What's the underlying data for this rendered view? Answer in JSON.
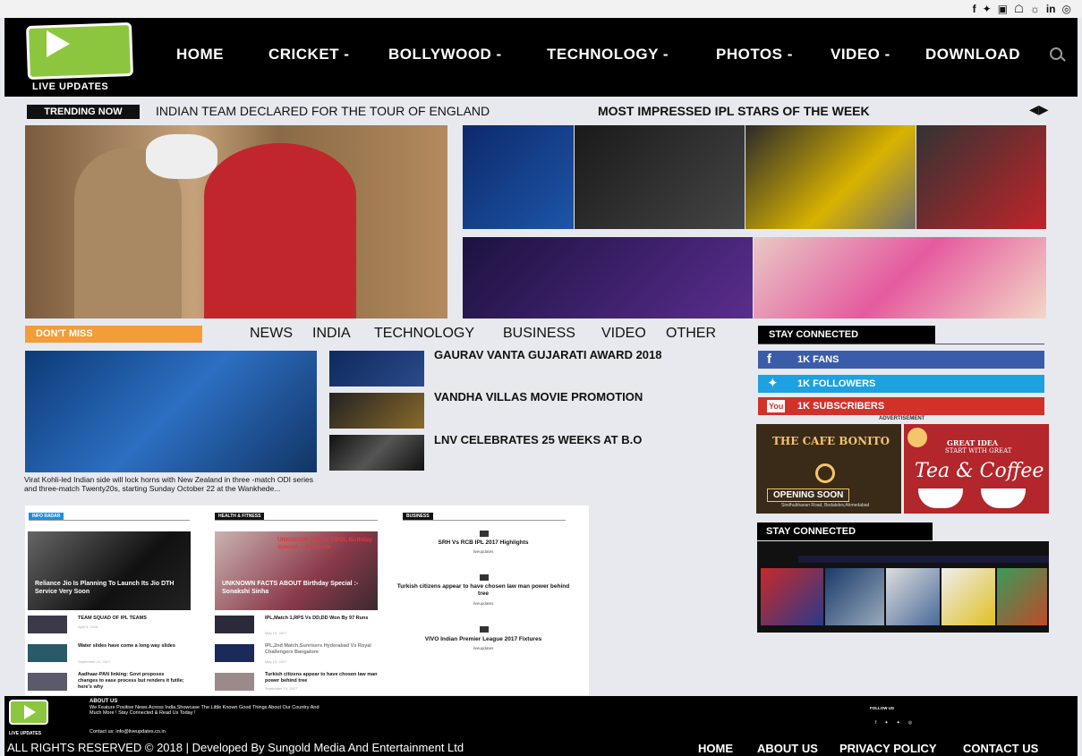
{
  "top_social": [
    "f",
    "✦",
    "▣",
    "☖",
    "☼",
    "in",
    "◎"
  ],
  "logo": {
    "text": "LIVE UPDATES"
  },
  "nav": [
    "HOME",
    "CRICKET -",
    "BOLLYWOOD -",
    "TECHNOLOGY -",
    "PHOTOS -",
    "VIDEO -",
    "DOWNLOAD"
  ],
  "trending": {
    "badge": "TRENDING NOW",
    "headline": "INDIAN TEAM DECLARED FOR THE TOUR OF ENGLAND",
    "headline2": "MOST IMPRESSED IPL STARS OF THE WEEK",
    "arrows": "◀▶"
  },
  "dont_miss": {
    "badge": "DON'T MISS",
    "categories": [
      "NEWS",
      "INDIA",
      "TECHNOLOGY",
      "BUSINESS",
      "VIDEO",
      "OTHER"
    ],
    "main_caption": "Virat Kohli-led Indian side will lock horns with New Zealand in three -match ODI series and three-match Twenty20s, starting Sunday October 22 at the Wankhede...",
    "stories": [
      "GAURAV VANTA GUJARATI AWARD 2018",
      "VANDHA VILLAS MOVIE PROMOTION",
      "LNV CELEBRATES 25 WEEKS AT B.O"
    ]
  },
  "stay_connected": {
    "title": "STAY CONNECTED",
    "facebook": "1K FANS",
    "twitter": "1K FOLLOWERS",
    "youtube": "1K SUBSCRIBERS",
    "colors": {
      "facebook": "#3b5ca8",
      "twitter": "#1da1e0",
      "youtube": "#d2312a"
    }
  },
  "advertisement": {
    "label": "ADVERTISEMENT",
    "ad1_title": "THE CAFE BONITO",
    "ad1_open": "OPENING SOON",
    "ad1_loc": "Sindhubhavan Road, Bodakdev,Ahmedabad",
    "ad2_line1": "GREAT IDEA",
    "ad2_line2": "START WITH GREAT",
    "ad2_main": "Tea & Coffee"
  },
  "panel": {
    "col1": {
      "header": "INFO RADAR",
      "feature": "Reliance Jio Is Planning To Launch Its Jio DTH Service Very Soon",
      "items": [
        {
          "title": "TEAM SQUAD OF IPL TEAMS",
          "date": "April 9, 2018"
        },
        {
          "title": "Water slides have come a long way slides",
          "date": "September 19, 2017"
        },
        {
          "title": "Aadhaar-PAN linking: Govt proposes changes to ease process but renders it futile; here's why",
          "date": ""
        }
      ]
    },
    "col2": {
      "header": "HEALTH & FITNESS",
      "feature": "UNKNOWN FACTS ABOUT Birthday Special :- Sonakshi Sinha",
      "feature_overlay": "UNKNOWN FACTS ABOL Birthday Special :- Sonakshi",
      "items": [
        {
          "title": "IPL,Match 1,RPS Vs DD,DD Won By 97 Runs",
          "date": "May 15, 2017"
        },
        {
          "title": "IPL,2nd Match,Sunrisers Hyderabad Vs Royal Challengers Bangalore",
          "date": "May 15, 2017"
        },
        {
          "title": "Turkish citizens appear to have chosen law man power behind tree",
          "date": "September 19, 2017"
        }
      ]
    },
    "col3": {
      "header": "BUSINESS",
      "items": [
        {
          "title": "SRH Vs RCB IPL 2017 Highlights",
          "meta": "liveupdates"
        },
        {
          "title": "Turkish citizens appear to have chosen law man power behind tree",
          "meta": "liveupdates"
        },
        {
          "title": "VIVO Indian Premier League 2017 Fixtures",
          "meta": "liveupdates"
        }
      ]
    }
  },
  "stay_connected2": {
    "title": "STAY CONNECTED"
  },
  "footer": {
    "logo_text": "LIVE UPDATES",
    "about_title": "ABOUT US",
    "about_text": "We Feature Positive News Across India,Showcase The Little Known Good Things About Our Country And Much More ! Stay Connected & Read Us Today !",
    "contact": "Contact us: info@liveupdates.co.in",
    "follow": "FOLLOW US",
    "social": [
      "f",
      "✦",
      "✦",
      "◎"
    ],
    "copyright": "ALL RIGHTS RESERVED © 2018  |  Developed By Sungold Media And Entertainment Ltd",
    "nav": [
      "HOME",
      "ABOUT US",
      "PRIVACY POLICY",
      "CONTACT US"
    ]
  }
}
